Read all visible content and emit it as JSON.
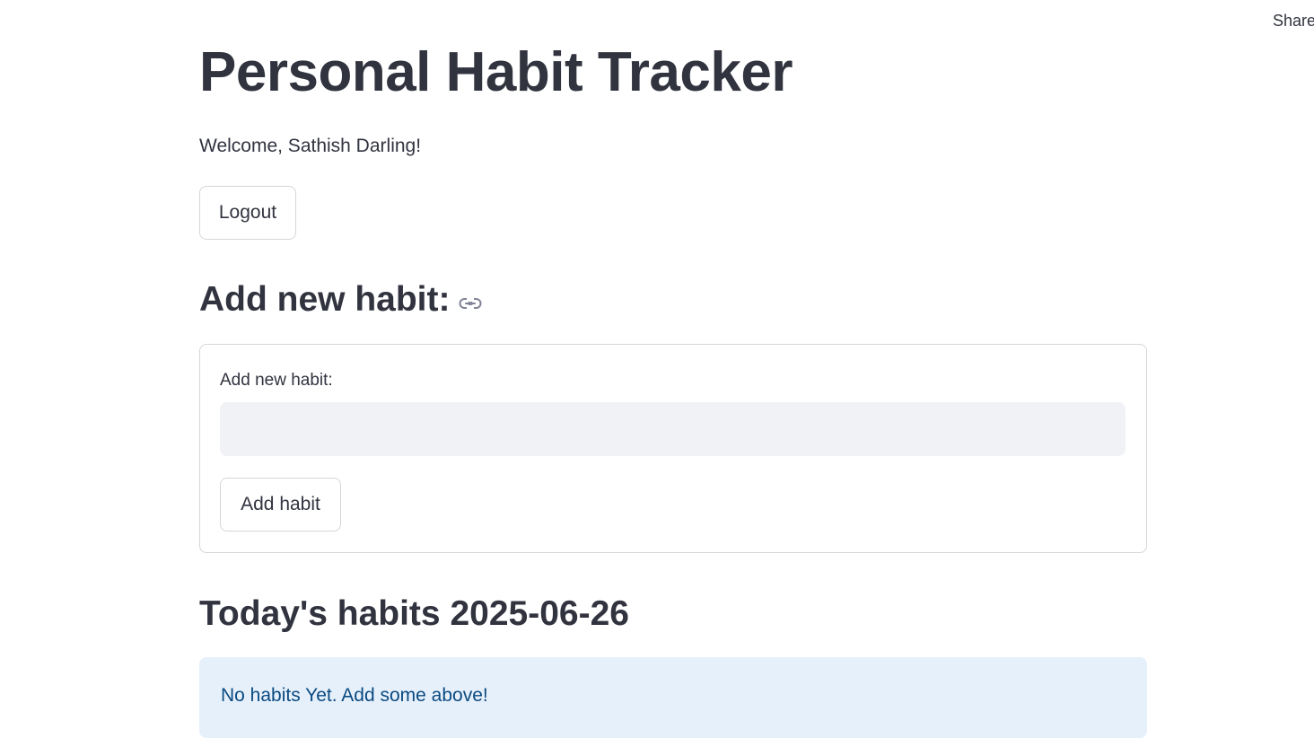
{
  "header": {
    "share_label": "Share"
  },
  "page": {
    "title": "Personal Habit Tracker",
    "welcome_text": "Welcome, Sathish Darling!",
    "logout_label": "Logout"
  },
  "add_section": {
    "heading": "Add new habit:",
    "anchor_icon": "link-icon",
    "form": {
      "label": "Add new habit:",
      "input_value": "",
      "input_placeholder": "",
      "submit_label": "Add habit"
    }
  },
  "today_section": {
    "heading_prefix": "Today's habits",
    "date": "2025-06-26",
    "empty_message": "No habits Yet. Add some above!"
  },
  "colors": {
    "text": "#31333f",
    "input_bg": "#f0f2f6",
    "info_bg": "#e6f0fb",
    "info_text": "#0b4a80",
    "border": "#d5d6da"
  }
}
